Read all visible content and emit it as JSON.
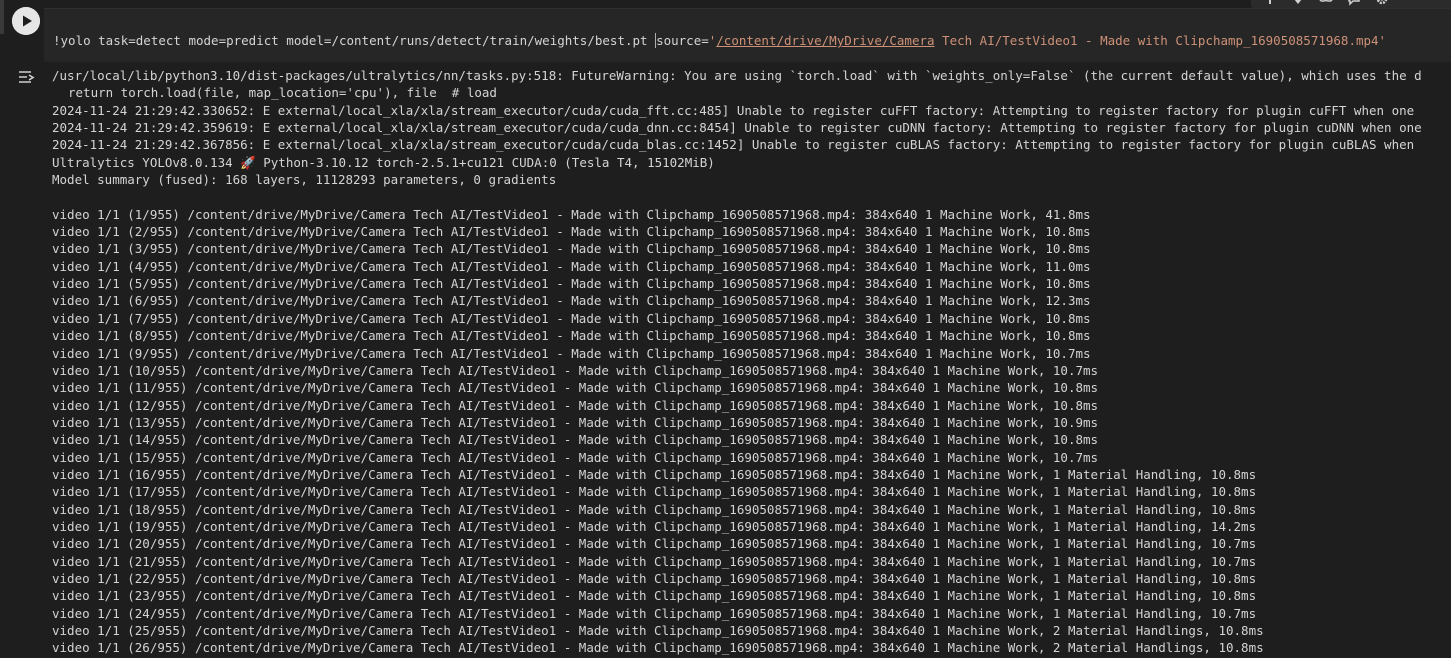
{
  "cell": {
    "command": "!yolo task=detect mode=predict model=/content/runs/detect/train/weights/best.pt ",
    "source_prefix": "source=",
    "source_quote_open": "'",
    "source_link": "/content/drive/MyDrive/Camera",
    "source_rest": " Tech AI/TestVideo1 - Made with Clipchamp_1690508571968.mp4'"
  },
  "toolbar": {
    "icons": [
      "arrow-up-icon",
      "arrow-down-icon",
      "link-icon",
      "comment-icon",
      "settings-icon"
    ]
  },
  "output": {
    "header_lines": [
      "/usr/local/lib/python3.10/dist-packages/ultralytics/nn/tasks.py:518: FutureWarning: You are using `torch.load` with `weights_only=False` (the current default value), which uses the d"
    ],
    "indent_line": "return torch.load(file, map_location='cpu'), file  # load",
    "error_lines": [
      "2024-11-24 21:29:42.330652: E external/local_xla/xla/stream_executor/cuda/cuda_fft.cc:485] Unable to register cuFFT factory: Attempting to register factory for plugin cuFFT when one",
      "2024-11-24 21:29:42.359619: E external/local_xla/xla/stream_executor/cuda/cuda_dnn.cc:8454] Unable to register cuDNN factory: Attempting to register factory for plugin cuDNN when one",
      "2024-11-24 21:29:42.367856: E external/local_xla/xla/stream_executor/cuda/cuda_blas.cc:1452] Unable to register cuBLAS factory: Attempting to register factory for plugin cuBLAS when"
    ],
    "ultralytics_prefix": "Ultralytics YOLOv8.0.134 ",
    "rocket": "🚀",
    "ultralytics_suffix": " Python-3.10.12 torch-2.5.1+cu121 CUDA:0 (Tesla T4, 15102MiB)",
    "model_summary": "Model summary (fused): 168 layers, 11128293 parameters, 0 gradients",
    "video_lines": [
      "video 1/1 (1/955) /content/drive/MyDrive/Camera Tech AI/TestVideo1 - Made with Clipchamp_1690508571968.mp4: 384x640 1 Machine Work, 41.8ms",
      "video 1/1 (2/955) /content/drive/MyDrive/Camera Tech AI/TestVideo1 - Made with Clipchamp_1690508571968.mp4: 384x640 1 Machine Work, 10.8ms",
      "video 1/1 (3/955) /content/drive/MyDrive/Camera Tech AI/TestVideo1 - Made with Clipchamp_1690508571968.mp4: 384x640 1 Machine Work, 10.8ms",
      "video 1/1 (4/955) /content/drive/MyDrive/Camera Tech AI/TestVideo1 - Made with Clipchamp_1690508571968.mp4: 384x640 1 Machine Work, 11.0ms",
      "video 1/1 (5/955) /content/drive/MyDrive/Camera Tech AI/TestVideo1 - Made with Clipchamp_1690508571968.mp4: 384x640 1 Machine Work, 10.8ms",
      "video 1/1 (6/955) /content/drive/MyDrive/Camera Tech AI/TestVideo1 - Made with Clipchamp_1690508571968.mp4: 384x640 1 Machine Work, 12.3ms",
      "video 1/1 (7/955) /content/drive/MyDrive/Camera Tech AI/TestVideo1 - Made with Clipchamp_1690508571968.mp4: 384x640 1 Machine Work, 10.8ms",
      "video 1/1 (8/955) /content/drive/MyDrive/Camera Tech AI/TestVideo1 - Made with Clipchamp_1690508571968.mp4: 384x640 1 Machine Work, 10.8ms",
      "video 1/1 (9/955) /content/drive/MyDrive/Camera Tech AI/TestVideo1 - Made with Clipchamp_1690508571968.mp4: 384x640 1 Machine Work, 10.7ms",
      "video 1/1 (10/955) /content/drive/MyDrive/Camera Tech AI/TestVideo1 - Made with Clipchamp_1690508571968.mp4: 384x640 1 Machine Work, 10.7ms",
      "video 1/1 (11/955) /content/drive/MyDrive/Camera Tech AI/TestVideo1 - Made with Clipchamp_1690508571968.mp4: 384x640 1 Machine Work, 10.8ms",
      "video 1/1 (12/955) /content/drive/MyDrive/Camera Tech AI/TestVideo1 - Made with Clipchamp_1690508571968.mp4: 384x640 1 Machine Work, 10.8ms",
      "video 1/1 (13/955) /content/drive/MyDrive/Camera Tech AI/TestVideo1 - Made with Clipchamp_1690508571968.mp4: 384x640 1 Machine Work, 10.9ms",
      "video 1/1 (14/955) /content/drive/MyDrive/Camera Tech AI/TestVideo1 - Made with Clipchamp_1690508571968.mp4: 384x640 1 Machine Work, 10.8ms",
      "video 1/1 (15/955) /content/drive/MyDrive/Camera Tech AI/TestVideo1 - Made with Clipchamp_1690508571968.mp4: 384x640 1 Machine Work, 10.7ms",
      "video 1/1 (16/955) /content/drive/MyDrive/Camera Tech AI/TestVideo1 - Made with Clipchamp_1690508571968.mp4: 384x640 1 Machine Work, 1 Material Handling, 10.8ms",
      "video 1/1 (17/955) /content/drive/MyDrive/Camera Tech AI/TestVideo1 - Made with Clipchamp_1690508571968.mp4: 384x640 1 Machine Work, 1 Material Handling, 10.8ms",
      "video 1/1 (18/955) /content/drive/MyDrive/Camera Tech AI/TestVideo1 - Made with Clipchamp_1690508571968.mp4: 384x640 1 Machine Work, 1 Material Handling, 10.8ms",
      "video 1/1 (19/955) /content/drive/MyDrive/Camera Tech AI/TestVideo1 - Made with Clipchamp_1690508571968.mp4: 384x640 1 Machine Work, 1 Material Handling, 14.2ms",
      "video 1/1 (20/955) /content/drive/MyDrive/Camera Tech AI/TestVideo1 - Made with Clipchamp_1690508571968.mp4: 384x640 1 Machine Work, 1 Material Handling, 10.7ms",
      "video 1/1 (21/955) /content/drive/MyDrive/Camera Tech AI/TestVideo1 - Made with Clipchamp_1690508571968.mp4: 384x640 1 Machine Work, 1 Material Handling, 10.7ms",
      "video 1/1 (22/955) /content/drive/MyDrive/Camera Tech AI/TestVideo1 - Made with Clipchamp_1690508571968.mp4: 384x640 1 Machine Work, 1 Material Handling, 10.8ms",
      "video 1/1 (23/955) /content/drive/MyDrive/Camera Tech AI/TestVideo1 - Made with Clipchamp_1690508571968.mp4: 384x640 1 Machine Work, 1 Material Handling, 10.8ms",
      "video 1/1 (24/955) /content/drive/MyDrive/Camera Tech AI/TestVideo1 - Made with Clipchamp_1690508571968.mp4: 384x640 1 Machine Work, 1 Material Handling, 10.7ms",
      "video 1/1 (25/955) /content/drive/MyDrive/Camera Tech AI/TestVideo1 - Made with Clipchamp_1690508571968.mp4: 384x640 1 Machine Work, 2 Material Handlings, 10.8ms",
      "video 1/1 (26/955) /content/drive/MyDrive/Camera Tech AI/TestVideo1 - Made with Clipchamp_1690508571968.mp4: 384x640 1 Machine Work, 2 Material Handlings, 10.8ms"
    ]
  },
  "colors": {
    "background": "#1e1e1e",
    "editor_background": "#262626",
    "text": "#d4d4d4",
    "string": "#ce9178"
  }
}
